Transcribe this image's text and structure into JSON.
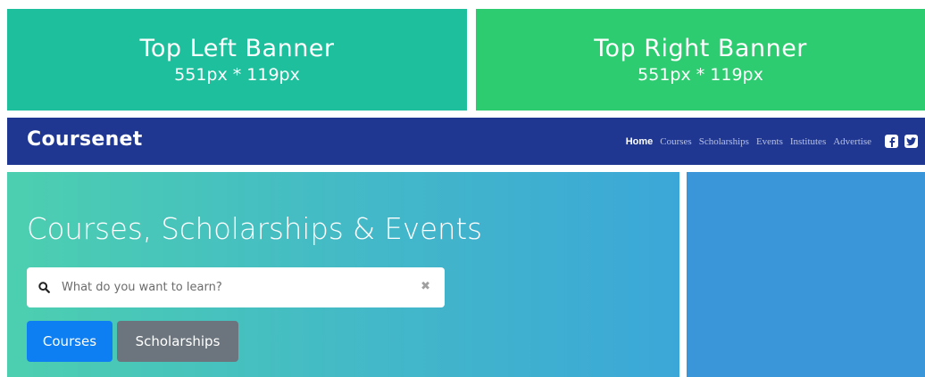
{
  "banners": {
    "left": {
      "title": "Top Left Banner",
      "size": "551px * 119px",
      "color": "#1dbf9c"
    },
    "right": {
      "title": "Top Right Banner",
      "size": "551px * 119px",
      "color": "#2ecc71"
    }
  },
  "navbar": {
    "brand": "Coursenet",
    "links": [
      "Home",
      "Courses",
      "Scholarships",
      "Events",
      "Institutes",
      "Advertise"
    ],
    "active": "Home",
    "social": [
      "facebook-icon",
      "twitter-icon"
    ],
    "color": "#1f3791"
  },
  "hero": {
    "title": "Courses, Scholarships & Events",
    "search": {
      "placeholder": "What do you want to learn?",
      "value": ""
    },
    "buttons": {
      "courses": "Courses",
      "scholarships": "Scholarships"
    }
  }
}
